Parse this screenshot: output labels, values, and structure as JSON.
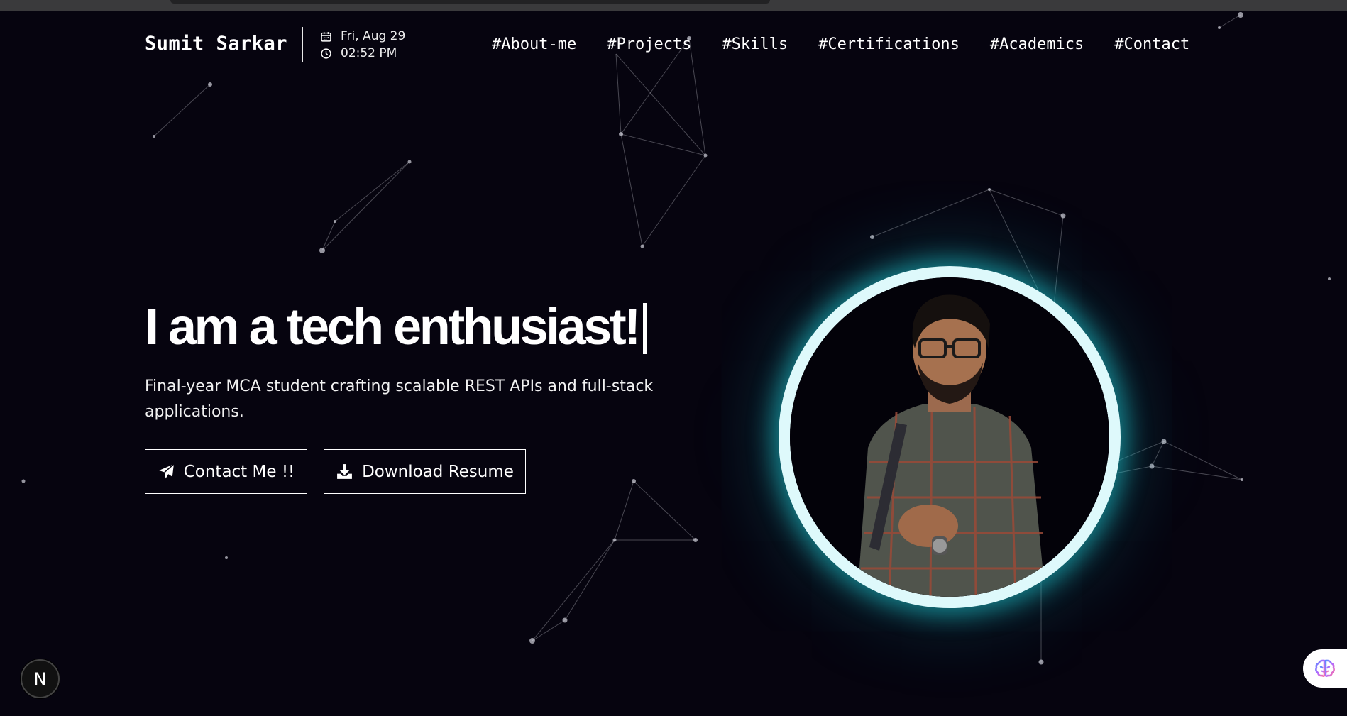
{
  "header": {
    "brand": "Sumit Sarkar",
    "date": "Fri, Aug 29",
    "time": "02:52 PM",
    "nav": [
      "#About-me",
      "#Projects",
      "#Skills",
      "#Certifications",
      "#Academics",
      "#Contact"
    ]
  },
  "hero": {
    "headline": "I am a tech enthusiast!",
    "subtitle": "Final-year MCA student crafting scalable REST APIs and full-stack applications.",
    "contact_label": "Contact Me !!",
    "resume_label": "Download Resume"
  },
  "badges": {
    "next_letter": "N"
  },
  "icons": {
    "calendar": "calendar-icon",
    "clock": "clock-icon",
    "send": "paper-plane-icon",
    "download": "download-icon",
    "chat": "brain-icon"
  },
  "colors": {
    "background": "#06040f",
    "text": "#ffffff",
    "glow": "#20cdd7",
    "ring": "#def9fb"
  }
}
